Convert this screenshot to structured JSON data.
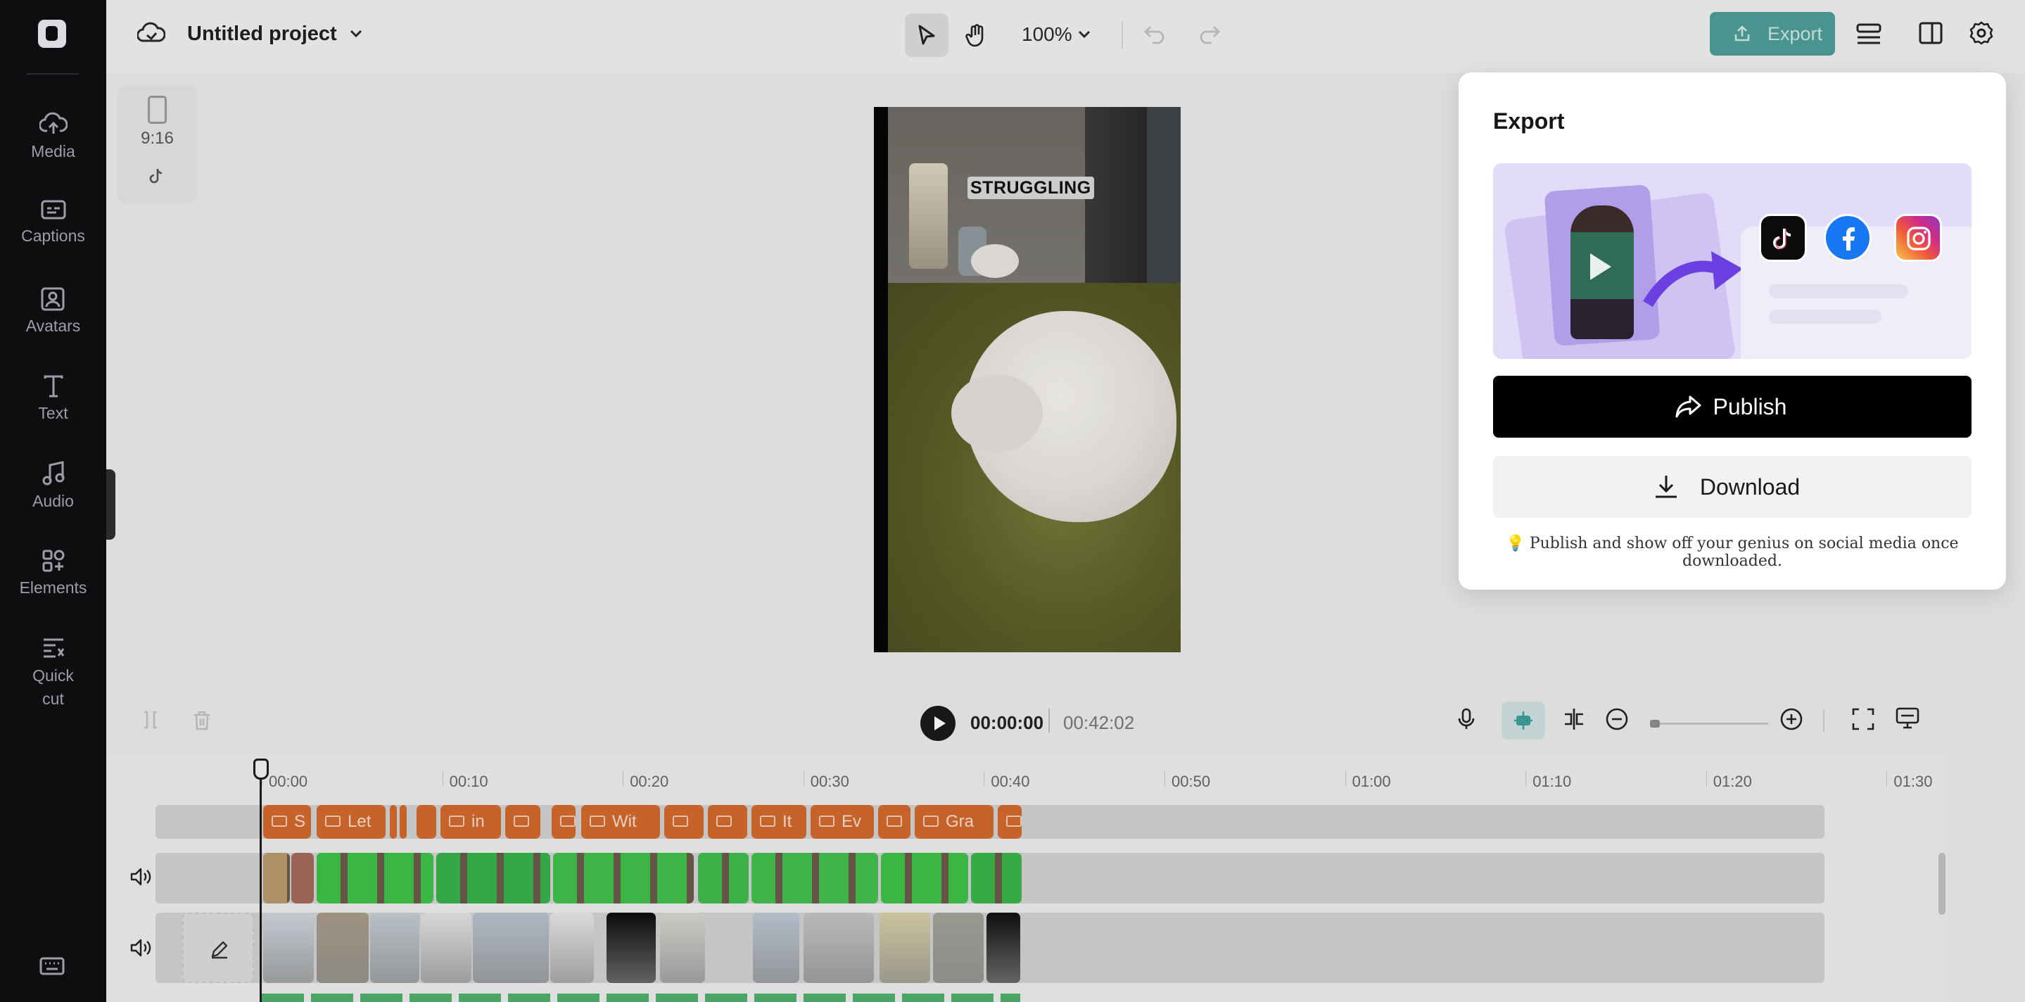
{
  "app": {
    "project_title": "Untitled project",
    "zoom": "100%",
    "export_label": "Export"
  },
  "rail": {
    "items": [
      {
        "label": "Media",
        "icon": "cloud-upload-icon"
      },
      {
        "label": "Captions",
        "icon": "captions-icon"
      },
      {
        "label": "Avatars",
        "icon": "avatar-icon"
      },
      {
        "label": "Text",
        "icon": "text-icon"
      },
      {
        "label": "Audio",
        "icon": "music-note-icon"
      },
      {
        "label": "Elements",
        "icon": "elements-icon"
      },
      {
        "label": "Quick cut",
        "icon": "quick-cut-icon"
      }
    ]
  },
  "aspect": {
    "ratio": "9:16",
    "platform_icon": "tiktok-icon"
  },
  "canvas": {
    "caption_text": "STRUGGLING"
  },
  "playback": {
    "current_time": "00:00:00",
    "total_time": "00:42:02",
    "zoom_level": 0.05
  },
  "timeline": {
    "ruler": [
      "00:00",
      "00:10",
      "00:20",
      "00:30",
      "00:40",
      "00:50",
      "01:00",
      "01:10",
      "01:20",
      "01:30"
    ],
    "caption_clips": [
      "S",
      "Let",
      "",
      "",
      "",
      "in",
      "",
      "(",
      "Wit",
      "",
      "",
      "It",
      "Ev",
      "",
      "Gra",
      ""
    ]
  },
  "export_panel": {
    "title": "Export",
    "publish_label": "Publish",
    "download_label": "Download",
    "tip": "Publish and show off your genius on social media once downloaded.",
    "social": [
      "tiktok-icon",
      "facebook-icon",
      "instagram-icon"
    ]
  },
  "colors": {
    "accent": "#4f9e9a",
    "caption_clip": "#d36a2e",
    "video_clip_green": "#3dbb4a"
  }
}
